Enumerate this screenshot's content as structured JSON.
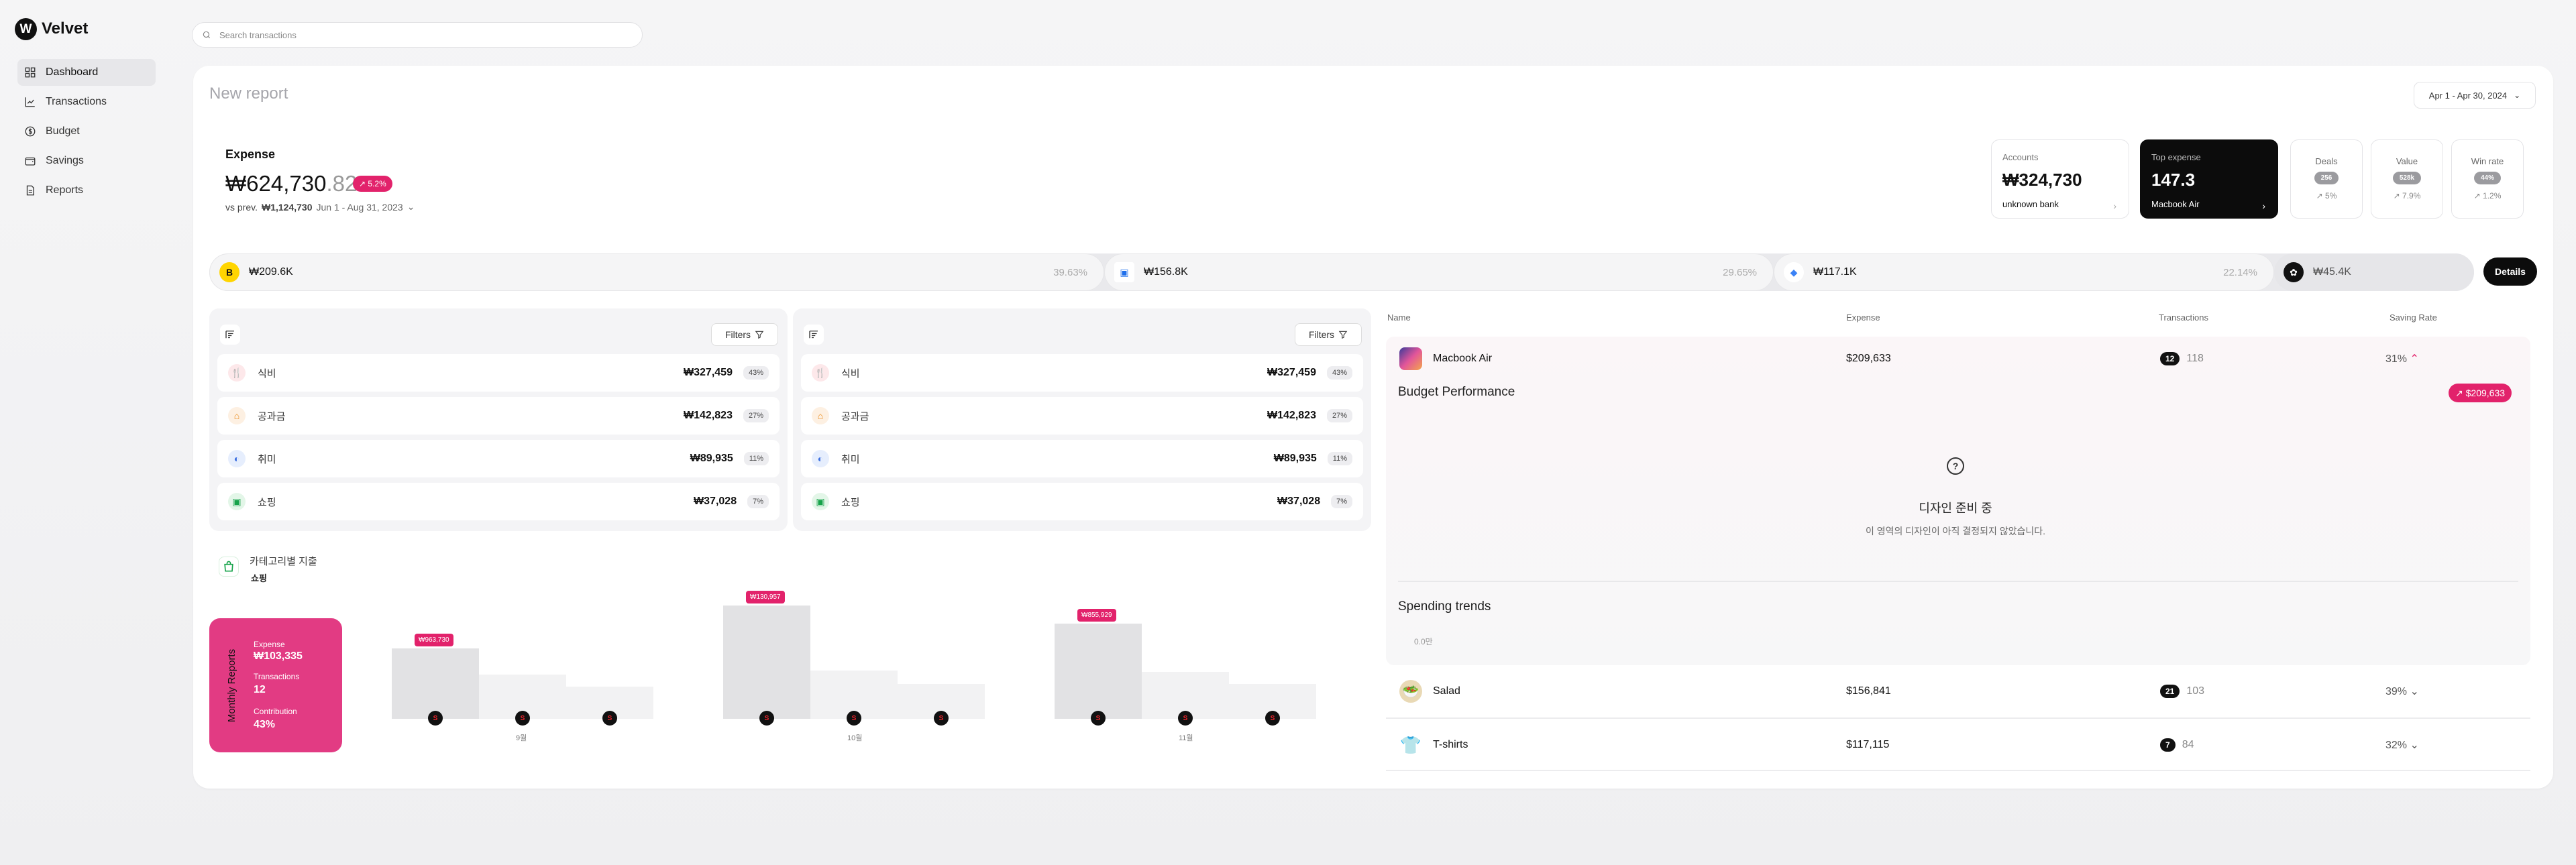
{
  "app": {
    "name": "Velvet",
    "logo_letter": "W"
  },
  "sidebar": {
    "items": [
      {
        "label": "Dashboard",
        "icon": "grid-icon",
        "active": true
      },
      {
        "label": "Transactions",
        "icon": "chart-icon"
      },
      {
        "label": "Budget",
        "icon": "dollar-icon"
      },
      {
        "label": "Savings",
        "icon": "wallet-icon"
      },
      {
        "label": "Reports",
        "icon": "document-icon"
      }
    ]
  },
  "search": {
    "placeholder": "Search transactions"
  },
  "report": {
    "title": "New report",
    "date_range": "Apr 1 - Apr 30, 2024"
  },
  "expense": {
    "label": "Expense",
    "amount_main": "₩624,730",
    "amount_decimal": ".82",
    "badge": "↗ 5.2%",
    "vs_label": "vs prev.",
    "vs_amount": "₩1,124,730",
    "vs_period": "Jun 1 - Aug 31, 2023"
  },
  "metrics": {
    "accounts": {
      "title": "Accounts",
      "value": "₩324,730",
      "sub": "unknown bank"
    },
    "top_expense": {
      "title": "Top expense",
      "value": "147.3",
      "sub": "Macbook Air"
    },
    "deals": {
      "title": "Deals",
      "pill": "256",
      "delta": "↗ 5%"
    },
    "value": {
      "title": "Value",
      "pill": "528k",
      "delta": "↗ 7.9%"
    },
    "win_rate": {
      "title": "Win rate",
      "pill": "44%",
      "delta": "↗ 1.2%"
    }
  },
  "strip": [
    {
      "value": "₩209.6K",
      "pct": "39.63%",
      "color": "#ffd500"
    },
    {
      "value": "₩156.8K",
      "pct": "29.65%",
      "color": "#1f6feb"
    },
    {
      "value": "₩117.1K",
      "pct": "22.14%",
      "color": "#3b82f6"
    },
    {
      "value": "₩45.4K",
      "pct": "",
      "color": "#111111"
    }
  ],
  "details_label": "Details",
  "panels": [
    {
      "filters": "Filters",
      "rows": [
        {
          "name": "식비",
          "amount": "₩327,459",
          "pct": "43%"
        },
        {
          "name": "공과금",
          "amount": "₩142,823",
          "pct": "27%"
        },
        {
          "name": "취미",
          "amount": "₩89,935",
          "pct": "11%"
        },
        {
          "name": "쇼핑",
          "amount": "₩37,028",
          "pct": "7%"
        }
      ]
    },
    {
      "filters": "Filters",
      "rows": [
        {
          "name": "식비",
          "amount": "₩327,459",
          "pct": "43%"
        },
        {
          "name": "공과금",
          "amount": "₩142,823",
          "pct": "27%"
        },
        {
          "name": "취미",
          "amount": "₩89,935",
          "pct": "11%"
        },
        {
          "name": "쇼핑",
          "amount": "₩37,028",
          "pct": "7%"
        }
      ]
    }
  ],
  "category": {
    "title": "카테고리별 지출",
    "sub": "쇼핑"
  },
  "monthly": {
    "vertical_label": "Monthly Reports",
    "expense_label": "Expense",
    "expense_value": "₩103,335",
    "tx_label": "Transactions",
    "tx_value": "12",
    "contrib_label": "Contribution",
    "contrib_value": "43%"
  },
  "chart_data": {
    "type": "bar",
    "groups": [
      {
        "month": "9월",
        "tag": "₩963,730",
        "values": [
          0.57,
          0.36,
          0.26
        ]
      },
      {
        "month": "10월",
        "tag": "₩130,957",
        "values": [
          0.92,
          0.39,
          0.28
        ]
      },
      {
        "month": "11월",
        "tag": "₩855,929",
        "values": [
          0.77,
          0.38,
          0.28
        ]
      }
    ]
  },
  "table": {
    "headers": {
      "name": "Name",
      "expense": "Expense",
      "transactions": "Transactions",
      "saving_rate": "Saving Rate"
    },
    "rows": [
      {
        "name": "Macbook Air",
        "expense": "$209,633",
        "tx_badge": "12",
        "tx": "118",
        "rate": "31%",
        "chev": "⌃"
      },
      {
        "name": "Salad",
        "expense": "$156,841",
        "tx_badge": "21",
        "tx": "103",
        "rate": "39%",
        "chev": "⌄"
      },
      {
        "name": "T-shirts",
        "expense": "$117,115",
        "tx_badge": "7",
        "tx": "84",
        "rate": "32%",
        "chev": "⌄"
      }
    ],
    "expanded": {
      "budget_title": "Budget Performance",
      "budget_badge": "↗ $209,633",
      "placeholder_icon": "?",
      "placeholder_title": "디자인 준비 중",
      "placeholder_sub": "이 영역의 디자인이 아직 결정되지 않았습니다.",
      "trends_title": "Spending trends",
      "trends_zero": "0.0만"
    }
  }
}
